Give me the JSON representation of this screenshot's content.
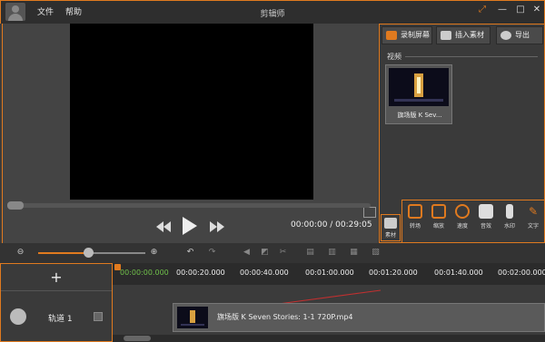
{
  "app": {
    "title": "剪辑师"
  },
  "menu": {
    "file": "文件",
    "help": "帮助"
  },
  "preview": {
    "time": "00:00:00 / 00:29:05"
  },
  "tabs": [
    {
      "label": "录制屏幕"
    },
    {
      "label": "插入素材"
    },
    {
      "label": "导出"
    }
  ],
  "library": {
    "section": "视频",
    "item_title": "旗场版 K Sev..."
  },
  "source_button": {
    "label": "素材"
  },
  "tools": [
    {
      "label": "转场"
    },
    {
      "label": "缩放"
    },
    {
      "label": "速度"
    },
    {
      "label": "音效"
    },
    {
      "label": "水印"
    },
    {
      "label": "文字"
    }
  ],
  "timeline": {
    "ticks": [
      "00:00:00.000",
      "00:00:20.000",
      "00:00:40.000",
      "00:01:00.000",
      "00:01:20.000",
      "00:01:40.000",
      "00:02:00.000"
    ],
    "add_symbol": "+",
    "track_name": "轨道 1",
    "clip_title": "旗场版 K Seven Stories: 1-1 720P.mp4"
  },
  "colors": {
    "accent": "#e07a1f",
    "playhead_time": "#6fc04a"
  }
}
